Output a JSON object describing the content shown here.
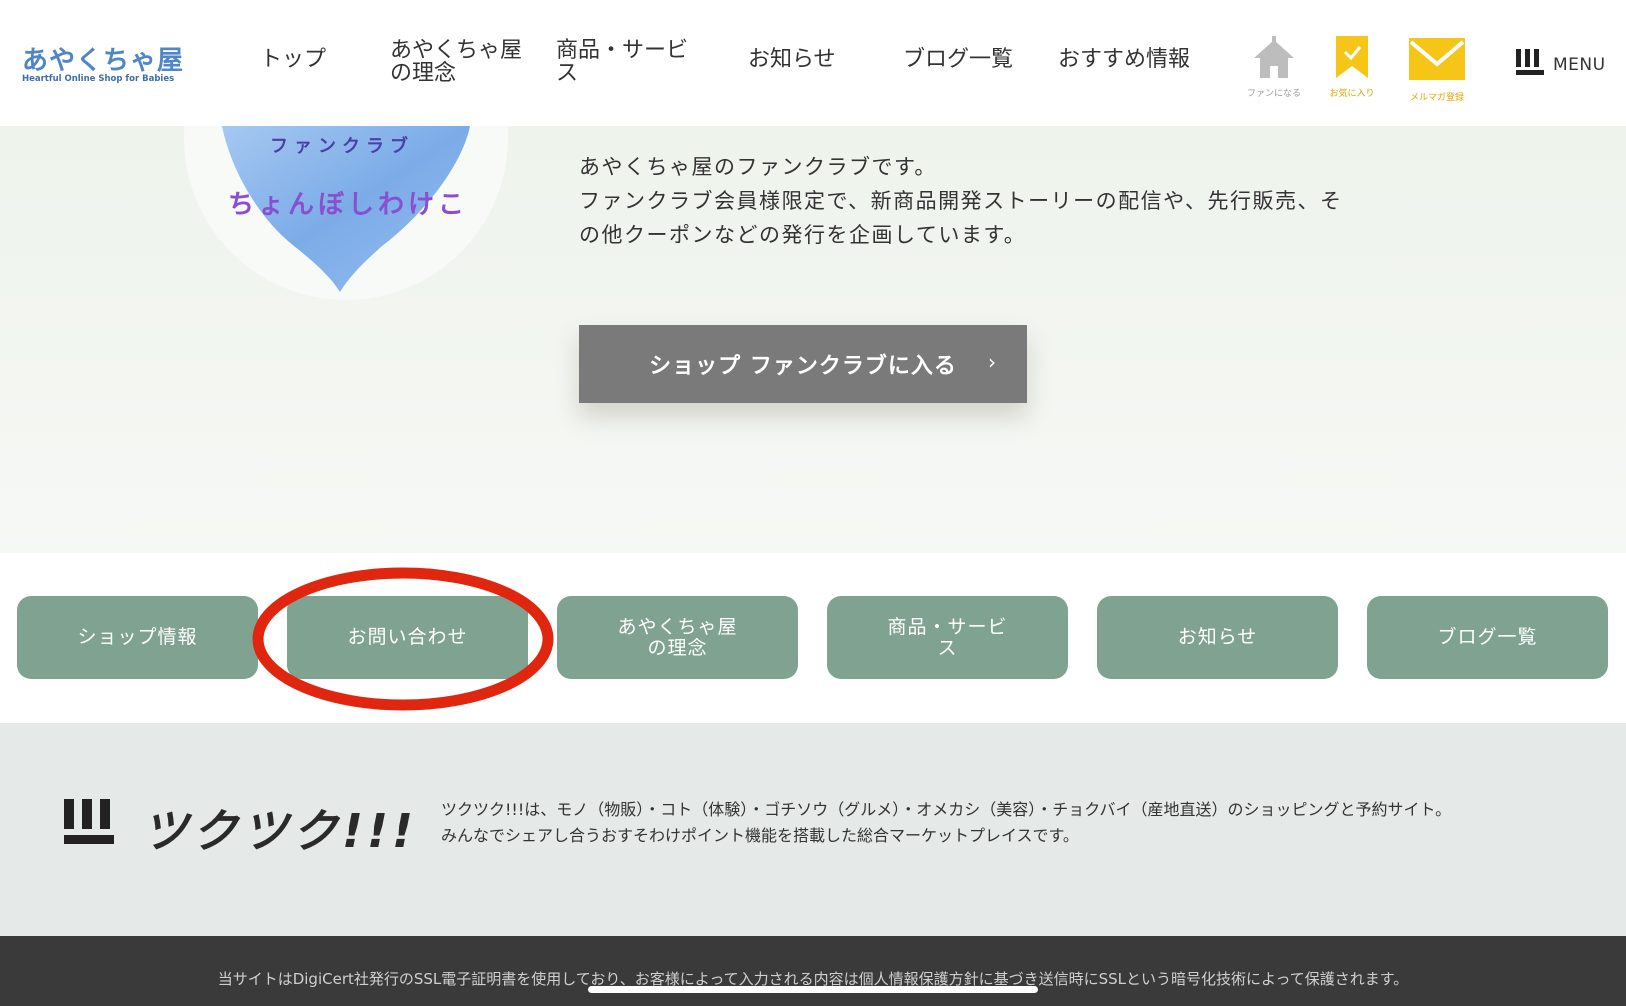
{
  "header": {
    "logo_text_main": "あやくちゃ屋",
    "logo_text_sub": "Heartful Online Shop for Babies",
    "nav": {
      "top": "トップ",
      "philosophy_l1": "あやくちゃ屋",
      "philosophy_l2": "の理念",
      "products_l1": "商品・サービ",
      "products_l2": "ス",
      "news": "お知らせ",
      "blog": "ブログ一覧",
      "recommend": "おすすめ情報"
    },
    "icons": {
      "fan": "ファンになる",
      "favorite": "お気に入り",
      "mail": "メルマガ登録"
    },
    "menu_label": "MENU",
    "colors": {
      "logo_blue": "#4f86c6",
      "accent_yellow": "#f5c518"
    }
  },
  "hero": {
    "heart_line1": "ファンクラブ",
    "heart_line2": "ちょんぼしわけこ",
    "description_line1": "あやくちゃ屋のファンクラブです。",
    "description_line2": "ファンクラブ会員様限定で、新商品開発ストーリーの配信や、先行販売、そ",
    "description_line3": "の他クーポンなどの発行を企画しています。",
    "join_button": "ショップ ファンクラブに入る",
    "join_chevron": "›"
  },
  "tabs": {
    "shop_info": "ショップ情報",
    "contact": "お問い合わせ",
    "philosophy_l1": "あやくちゃ屋",
    "philosophy_l2": "の理念",
    "products_l1": "商品・サービ",
    "products_l2": "ス",
    "news": "お知らせ",
    "blog": "ブログ一覧",
    "tab_color": "#80a391",
    "highlight_color": "#e0260f"
  },
  "info": {
    "brand": "ツクツク!!!",
    "text_line1": "ツクツク!!!は、モノ（物販）・コト（体験）・ゴチソウ（グルメ）・オメカシ（美容）・チョクバイ（産地直送）のショッピングと予約サイト。",
    "text_line2": "みんなでシェアし合うおすそわけポイント機能を搭載した総合マーケットプレイスです。"
  },
  "footer": {
    "ssl_notice": "当サイトはDigiCert社発行のSSL電子証明書を使用しており、お客様によって入力される内容は個人情報保護方針に基づき送信時にSSLという暗号化技術によって保護されます。"
  }
}
